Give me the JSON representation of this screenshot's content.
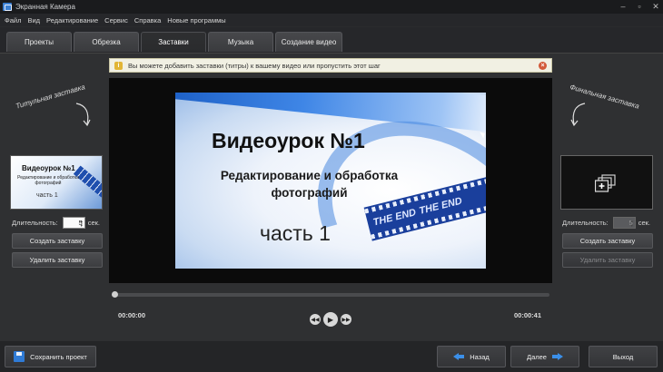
{
  "window": {
    "title": "Экранная Камера"
  },
  "menu": [
    "Файл",
    "Вид",
    "Редактирование",
    "Сервис",
    "Справка",
    "Новые программы"
  ],
  "tabs": [
    {
      "label": "Проекты"
    },
    {
      "label": "Обрезка"
    },
    {
      "label": "Заставки",
      "active": true
    },
    {
      "label": "Музыка"
    },
    {
      "label": "Создание видео"
    }
  ],
  "info": {
    "text": "Вы можете добавить заставки (титры) к вашему видео или пропустить этот шаг"
  },
  "left_panel": {
    "title": "Титульная заставка",
    "thumb_title": "Видеоурок №1",
    "thumb_sub": "Редактирование и обработка фотографий",
    "thumb_part": "часть 1",
    "duration_label": "Длительность:",
    "duration_value": "5",
    "duration_unit": "сек.",
    "create_button": "Создать заставку",
    "delete_button": "Удалить заставку"
  },
  "right_panel": {
    "title": "Финальная заставка",
    "duration_label": "Длительность:",
    "duration_value": "5",
    "duration_unit": "сек.",
    "create_button": "Создать заставку",
    "delete_button": "Удалить заставку"
  },
  "video": {
    "title": "Видеоурок №1",
    "subtitle": "Редактирование и обработка фотографий",
    "part": "часть 1",
    "film_text_1": "THE END",
    "film_text_2": "THE END"
  },
  "player": {
    "current_time": "00:00:00",
    "total_time": "00:00:41",
    "progress": 0
  },
  "bottom": {
    "save": "Сохранить проект",
    "back": "Назад",
    "next": "Далее",
    "exit": "Выход"
  },
  "icons": [
    "camera-app-icon",
    "info-icon",
    "close-icon",
    "add-screen-icon",
    "rewind-icon",
    "play-icon",
    "forward-icon",
    "save-icon",
    "arrow-left-icon",
    "arrow-right-icon"
  ]
}
